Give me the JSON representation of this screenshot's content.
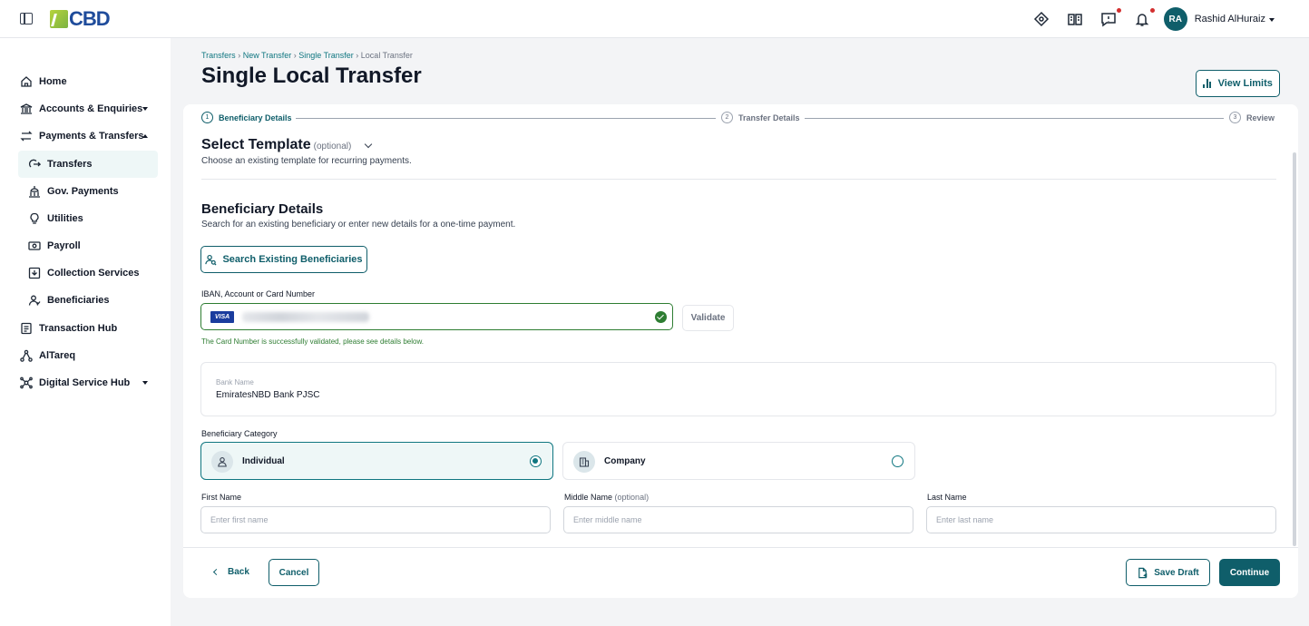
{
  "app": {
    "logo_text": "CBD"
  },
  "user": {
    "initials": "RA",
    "name": "Rashid AlHuraiz"
  },
  "colors": {
    "brand": "#0f5e6a",
    "success": "#2e7d32",
    "notification_dot": "#d32f2f",
    "active_nav_bg": "#eef7f7"
  },
  "sidebar": {
    "items": [
      {
        "label": "Home",
        "icon": "home-icon"
      },
      {
        "label": "Accounts & Enquiries",
        "icon": "bank-icon",
        "expandable": true
      },
      {
        "label": "Payments & Transfers",
        "icon": "transfer-arrows-icon",
        "expanded": true
      },
      {
        "label": "Transfers",
        "icon": "transfer-icon",
        "active": true
      },
      {
        "label": "Gov. Payments",
        "icon": "government-icon"
      },
      {
        "label": "Utilities",
        "icon": "bulb-icon"
      },
      {
        "label": "Payroll",
        "icon": "money-icon"
      },
      {
        "label": "Collection Services",
        "icon": "collection-icon"
      },
      {
        "label": "Beneficiaries",
        "icon": "beneficiaries-icon"
      },
      {
        "label": "Transaction Hub",
        "icon": "document-icon"
      },
      {
        "label": "AlTareq",
        "icon": "network-icon"
      },
      {
        "label": "Digital Service Hub",
        "icon": "hub-icon",
        "expandable": true
      }
    ]
  },
  "breadcrumb": [
    "Transfers",
    "New Transfer",
    "Single Transfer",
    "Local Transfer"
  ],
  "page": {
    "title": "Single Local Transfer",
    "view_limits": "View Limits"
  },
  "stepper": [
    {
      "num": "1",
      "label": "Beneficiary Details",
      "active": true
    },
    {
      "num": "2",
      "label": "Transfer Details"
    },
    {
      "num": "3",
      "label": "Review"
    }
  ],
  "template": {
    "title": "Select Template",
    "optional": "(optional)",
    "subtitle": "Choose an existing template for recurring payments."
  },
  "beneficiary": {
    "title": "Beneficiary Details",
    "subtitle": "Search for an existing beneficiary or enter new details for a one-time payment.",
    "search_button": "Search Existing Beneficiaries",
    "iban_label": "IBAN, Account or Card Number",
    "card_brand": "VISA",
    "validate_button": "Validate",
    "valid_message": "The Card Number is successfully validated, please see details below.",
    "bank_name_label": "Bank Name",
    "bank_name_value": "EmiratesNBD Bank PJSC",
    "category_label": "Beneficiary Category",
    "categories": [
      {
        "label": "Individual",
        "selected": true
      },
      {
        "label": "Company",
        "selected": false
      }
    ],
    "first_name": {
      "label": "First Name",
      "placeholder": "Enter first name"
    },
    "middle_name": {
      "label": "Middle Name",
      "optional": "(optional)",
      "placeholder": "Enter middle name"
    },
    "last_name": {
      "label": "Last Name",
      "placeholder": "Enter last name"
    }
  },
  "footer": {
    "back": "Back",
    "cancel": "Cancel",
    "save_draft": "Save Draft",
    "continue": "Continue"
  }
}
